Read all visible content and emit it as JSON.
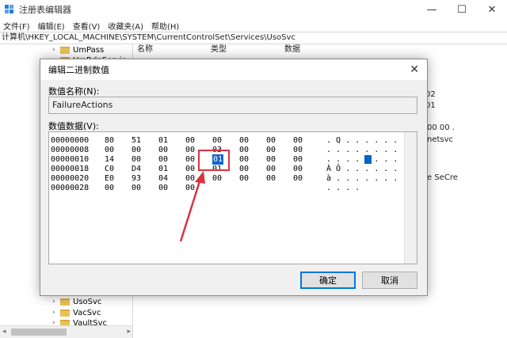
{
  "window": {
    "title": "注册表编辑器",
    "minimize": "—",
    "maximize": "☐",
    "close": "✕"
  },
  "menu": [
    "文件(F)",
    "编辑(E)",
    "查看(V)",
    "收藏夹(A)",
    "帮助(H)"
  ],
  "address": "计算机\\HKEY_LOCAL_MACHINE\\SYSTEM\\CurrentControlSet\\Services\\UsoSvc",
  "tree": {
    "top_items": [
      "UmPass",
      "UmRdpServic"
    ],
    "bottom_items": [
      "UsoSvc",
      "VacSvc",
      "VaultSvc"
    ]
  },
  "list": {
    "columns": [
      "名称",
      "类型",
      "数据"
    ],
    "fragments": [
      "02",
      "01",
      "00 00 .",
      "netsvc",
      "e SeCre"
    ]
  },
  "dialog": {
    "title": "编辑二进制数值",
    "close": "✕",
    "name_label": "数值名称(N):",
    "name_value": "FailureActions",
    "data_label": "数值数据(V):",
    "ok": "确定",
    "cancel": "取消"
  },
  "hex_rows": [
    {
      "addr": "00000000",
      "bytes": [
        "80",
        "51",
        "01",
        "00",
        "00",
        "00",
        "00",
        "00"
      ],
      "ascii": ". Q . . . . . ."
    },
    {
      "addr": "00000008",
      "bytes": [
        "00",
        "00",
        "00",
        "00",
        "03",
        "00",
        "00",
        "00"
      ],
      "ascii": ". . . . . . . ."
    },
    {
      "addr": "00000010",
      "bytes": [
        "14",
        "00",
        "00",
        "00",
        "01",
        "00",
        "00",
        "00"
      ],
      "ascii": ". . . . . . . ."
    },
    {
      "addr": "00000018",
      "bytes": [
        "C0",
        "D4",
        "01",
        "00",
        "01",
        "00",
        "00",
        "00"
      ],
      "ascii": "À Ô . . . . . ."
    },
    {
      "addr": "00000020",
      "bytes": [
        "E0",
        "93",
        "04",
        "00",
        "00",
        "00",
        "00",
        "00"
      ],
      "ascii": "à . . . . . . ."
    },
    {
      "addr": "00000028",
      "bytes": [
        "00",
        "00",
        "00",
        "00"
      ],
      "ascii": ". . . ."
    }
  ],
  "selection": {
    "row": 2,
    "byte": 4,
    "ascii_index": 4
  },
  "colors": {
    "selection": "#0a64c8",
    "annotation": "#d9333f"
  }
}
